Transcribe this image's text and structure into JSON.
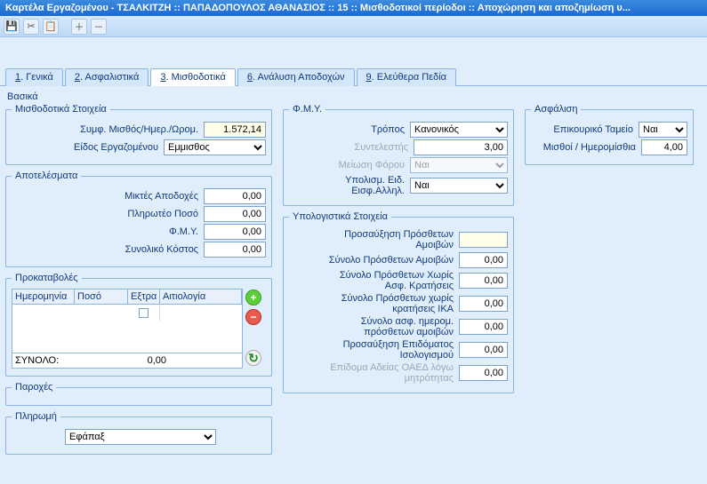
{
  "titlebar": "Καρτέλα Εργαζομένου - ΤΣΑΛΚΙΤΖΗ :: ΠΑΠΑΔΟΠΟΥΛΟΣ ΑΘΑΝΑΣΙΟΣ  :: 15  :: Μισθοδοτικοί περίοδοι :: Αποχώρηση και αποζημίωση υ...",
  "tabs": {
    "t1": "Γενικά",
    "t2": "Ασφαλιστικά",
    "t3": "Μισθοδοτικά",
    "t6": "Ανάλυση Αποδοχών",
    "t9": "Ελεύθερα Πεδία"
  },
  "basics_title": "Βασικά",
  "groups": {
    "misth_stoixeia": "Μισθοδοτικά Στοιχεία",
    "apotelesmata": "Αποτελέσματα",
    "prokataboles": "Προκαταβολές",
    "paroxes": "Παροχές",
    "pliromi": "Πληρωμή",
    "fmy": "Φ.Μ.Υ.",
    "ypologistika": "Υπολογιστικά Στοιχεία",
    "asfalisi": "Ασφάλιση"
  },
  "left": {
    "symf_label": "Συμφ. Μισθός/Ημερ./Ωρομ.",
    "symf_value": "1.572,14",
    "eidos_label": "Είδος Εργαζομένου",
    "eidos_value": "Εμμισθος",
    "miktes_label": "Μικτές Αποδοχές",
    "miktes_value": "0,00",
    "plir_label": "Πληρωτέο Ποσό",
    "plir_value": "0,00",
    "fmy_label": "Φ.Μ.Υ.",
    "fmy_value": "0,00",
    "kostos_label": "Συνολικό Κόστος",
    "kostos_value": "0,00"
  },
  "grid": {
    "h1": "Ημερομηνία",
    "h2": "Ποσό",
    "h3": "Εξτρα",
    "h4": "Αιτιολογία",
    "sum_label": "ΣΥΝΟΛΟ:",
    "sum_value": "0,00"
  },
  "pliromi_value": "Εφάπαξ",
  "fmy": {
    "tropos_label": "Τρόπος",
    "tropos_value": "Κανονικός",
    "syntel_label": "Συντελεστής",
    "syntel_value": "3,00",
    "meiosi_label": "Μείωση Φόρου",
    "meiosi_value": "Ναι",
    "ypolism_label": "Υπολισμ. Ειδ. Εισφ.Αλληλ.",
    "ypolism_value": "Ναι"
  },
  "ypolog": {
    "r1_label": "Προσαύξηση Πρόσθετων Αμοιβών",
    "r1_value": "",
    "r2_label": "Σύνολο Πρόσθετων Αμοιβών",
    "r2_value": "0,00",
    "r3_label": "Σύνολο Πρόσθετων Χωρίς Ασφ. Κρατήσεις",
    "r3_value": "0,00",
    "r4_label": "Σύνολο Πρόσθετων χωρίς κρατήσεις ΙΚΑ",
    "r4_value": "0,00",
    "r5_label": "Σύνολο ασφ. ημερομ. πρόσθετων αμοιβών",
    "r5_value": "0,00",
    "r6_label": "Προσαύξηση Επιδόματος Ισολογισμού",
    "r6_value": "0,00",
    "r7_label": "Επίδομα Αδείας ΟΑΕΔ λόγω μητρότητας",
    "r7_value": "0,00"
  },
  "asf": {
    "epik_label": "Επικουρικό Ταμείο",
    "epik_value": "Ναι",
    "misth_label": "Μισθοί / Ημερομίσθια",
    "misth_value": "4,00"
  }
}
